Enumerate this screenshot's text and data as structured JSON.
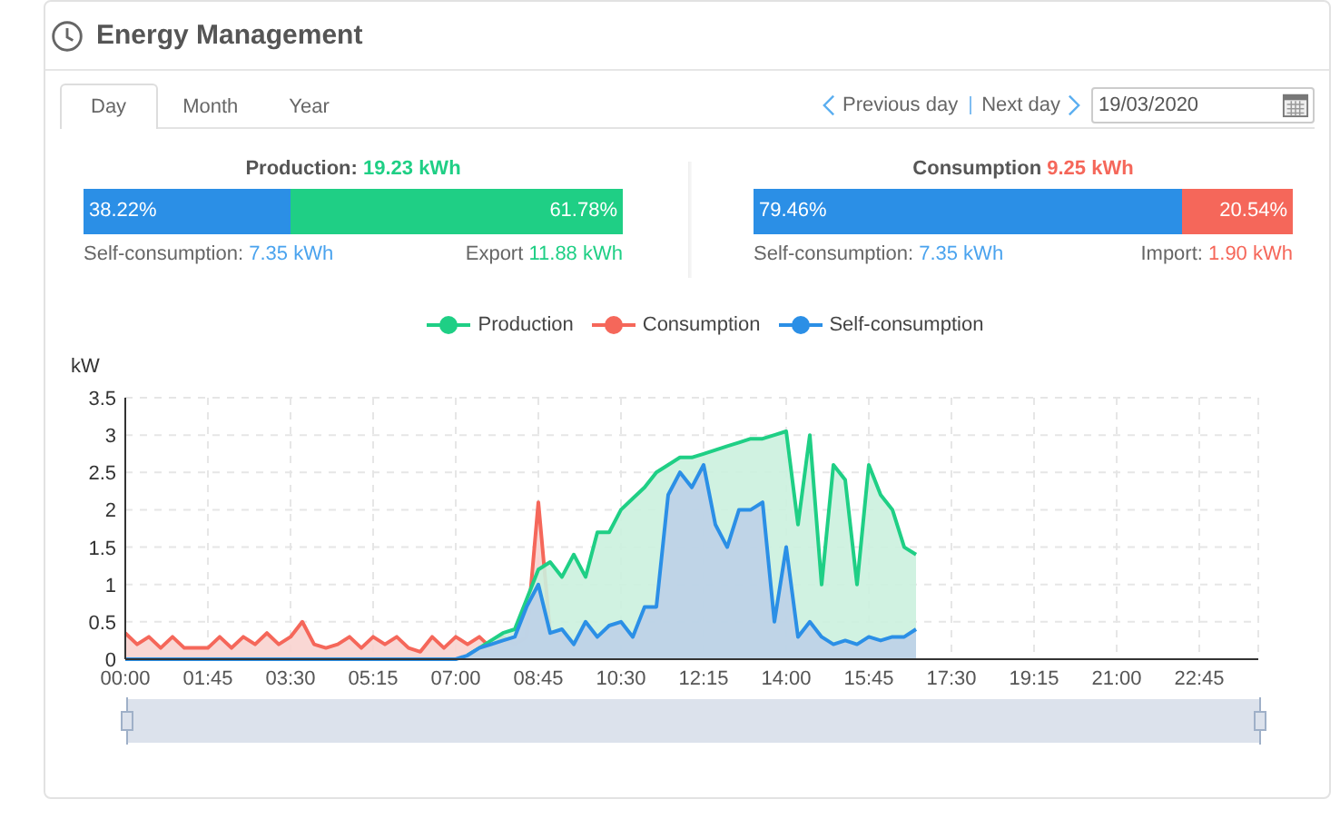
{
  "header": {
    "title": "Energy Management"
  },
  "tabs": [
    {
      "label": "Day",
      "selected": true
    },
    {
      "label": "Month",
      "selected": false
    },
    {
      "label": "Year",
      "selected": false
    }
  ],
  "date_nav": {
    "previous": "Previous day",
    "next": "Next day",
    "date": "19/03/2020"
  },
  "summaries": [
    {
      "kind": "production",
      "label": "Production:",
      "value": "19.23 kWh",
      "share": {
        "level": 0.3822,
        "left_text": "38.22%",
        "right_text": "61.78%"
      },
      "left_label": "Self-consumption:",
      "left_value": "7.35 kWh",
      "right_label": "Export",
      "right_value": "11.88 kWh"
    },
    {
      "kind": "consumption",
      "label": "Consumption",
      "value": "9.25 kWh",
      "share": {
        "level": 0.7946,
        "left_text": "79.46%",
        "right_text": "20.54%"
      },
      "left_label": "Self-consumption:",
      "left_value": "7.35 kWh",
      "right_label": "Import:",
      "right_value": "1.90 kWh"
    }
  ],
  "chart": {
    "chart_data": {
      "type": "area",
      "ylabel": "kW",
      "grid": true,
      "xlim": [
        0,
        24
      ],
      "ylim": [
        0,
        3.5
      ],
      "yticks": [
        0,
        0.5,
        1,
        1.5,
        2,
        2.5,
        3,
        3.5
      ],
      "xticks": [
        {
          "value": 0,
          "label": "00:00"
        },
        {
          "value": 1.75,
          "label": "01:45"
        },
        {
          "value": 3.5,
          "label": "03:30"
        },
        {
          "value": 5.25,
          "label": "05:15"
        },
        {
          "value": 7,
          "label": "07:00"
        },
        {
          "value": 8.75,
          "label": "08:45"
        },
        {
          "value": 10.5,
          "label": "10:30"
        },
        {
          "value": 12.25,
          "label": "12:15"
        },
        {
          "value": 14,
          "label": "14:00"
        },
        {
          "value": 15.75,
          "label": "15:45"
        },
        {
          "value": 17.5,
          "label": "17:30"
        },
        {
          "value": 19.25,
          "label": "19:15"
        },
        {
          "value": 21,
          "label": "21:00"
        },
        {
          "value": 22.75,
          "label": "22:45"
        }
      ],
      "x": [
        0,
        0.25,
        0.5,
        0.75,
        1,
        1.25,
        1.5,
        1.75,
        2,
        2.25,
        2.5,
        2.75,
        3,
        3.25,
        3.5,
        3.75,
        4,
        4.25,
        4.5,
        4.75,
        5,
        5.25,
        5.5,
        5.75,
        6,
        6.25,
        6.5,
        6.75,
        7,
        7.25,
        7.5,
        7.75,
        8,
        8.25,
        8.5,
        8.75,
        9,
        9.25,
        9.5,
        9.75,
        10,
        10.25,
        10.5,
        10.75,
        11,
        11.25,
        11.5,
        11.75,
        12,
        12.25,
        12.5,
        12.75,
        13,
        13.25,
        13.5,
        13.75,
        14,
        14.25,
        14.5,
        14.75,
        15,
        15.25,
        15.5,
        15.75,
        16,
        16.25,
        16.5,
        16.75
      ],
      "series": [
        {
          "name": "Production",
          "color": "#1fcf85",
          "values": [
            null,
            null,
            null,
            null,
            null,
            null,
            null,
            null,
            null,
            null,
            null,
            null,
            null,
            null,
            null,
            null,
            null,
            null,
            null,
            null,
            null,
            null,
            null,
            null,
            null,
            null,
            null,
            null,
            null,
            0.05,
            0.15,
            0.25,
            0.35,
            0.4,
            0.8,
            1.2,
            1.3,
            1.1,
            1.4,
            1.1,
            1.7,
            1.7,
            2.0,
            2.15,
            2.3,
            2.5,
            2.6,
            2.7,
            2.7,
            2.75,
            2.8,
            2.85,
            2.9,
            2.95,
            2.95,
            3.0,
            3.05,
            1.8,
            3.0,
            1.0,
            2.6,
            2.4,
            1.0,
            2.6,
            2.2,
            2.0,
            1.5,
            1.4
          ]
        },
        {
          "name": "Consumption",
          "color": "#f5675a",
          "values": [
            0.35,
            0.2,
            0.3,
            0.15,
            0.3,
            0.15,
            0.15,
            0.15,
            0.3,
            0.15,
            0.3,
            0.2,
            0.35,
            0.2,
            0.3,
            0.5,
            0.2,
            0.15,
            0.2,
            0.3,
            0.15,
            0.3,
            0.2,
            0.3,
            0.15,
            0.1,
            0.3,
            0.15,
            0.3,
            0.2,
            0.3,
            0.15,
            0.3,
            0.2,
            0.3,
            2.1,
            0.35,
            null,
            null,
            null,
            null,
            null,
            null,
            null,
            null,
            null,
            null,
            null,
            null,
            null,
            null,
            null,
            null,
            null,
            null,
            null,
            null,
            null,
            null,
            null,
            null,
            null,
            null,
            null,
            null,
            null,
            null,
            null
          ]
        },
        {
          "name": "Self-consumption",
          "color": "#2b8fe6",
          "values": [
            0,
            0,
            0,
            0,
            0,
            0,
            0,
            0,
            0,
            0,
            0,
            0,
            0,
            0,
            0,
            0,
            0,
            0,
            0,
            0,
            0,
            0,
            0,
            0,
            0,
            0,
            0,
            0,
            0,
            0.05,
            0.15,
            0.2,
            0.25,
            0.3,
            0.7,
            1.0,
            0.35,
            0.4,
            0.2,
            0.5,
            0.3,
            0.45,
            0.5,
            0.3,
            0.7,
            0.7,
            2.2,
            2.5,
            2.3,
            2.6,
            1.8,
            1.5,
            2.0,
            2.0,
            2.1,
            0.5,
            1.5,
            0.3,
            0.5,
            0.3,
            0.2,
            0.25,
            0.2,
            0.3,
            0.25,
            0.3,
            0.3,
            0.4
          ]
        }
      ]
    }
  }
}
